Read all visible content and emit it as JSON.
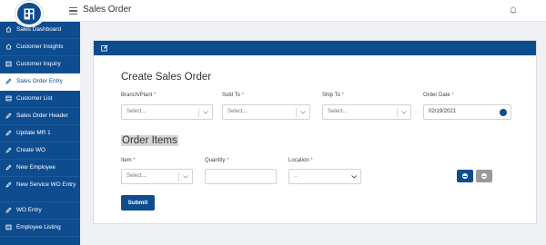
{
  "header": {
    "title": "Sales Order",
    "logo_icon": "building-icon",
    "notification_icon": "bell-icon"
  },
  "sidebar": {
    "items": [
      {
        "label": "Sales Dashboard",
        "icon": "home-icon"
      },
      {
        "label": "Customer Insights",
        "icon": "home-icon"
      },
      {
        "label": "Customer Inquiry",
        "icon": "table-icon"
      },
      {
        "label": "Sales Order Entry",
        "icon": "pencil-icon",
        "active": true
      },
      {
        "label": "Customer List",
        "icon": "table-icon"
      },
      {
        "label": "Sales Order Header",
        "icon": "pencil-icon"
      },
      {
        "label": "Update MR 1",
        "icon": "pencil-icon"
      },
      {
        "label": "Create WO",
        "icon": "pencil-icon"
      },
      {
        "label": "New Employee",
        "icon": "pencil-icon"
      },
      {
        "label": "New Service WO Entry",
        "icon": "pencil-icon"
      },
      {
        "label": "WO Entry",
        "icon": "pencil-icon"
      },
      {
        "label": "Employee Listing",
        "icon": "table-icon"
      }
    ]
  },
  "form": {
    "title": "Create Sales Order",
    "branch_label": "Branch/Plant",
    "branch_placeholder": "Select...",
    "sold_to_label": "Sold To",
    "sold_to_placeholder": "Select...",
    "ship_to_label": "Ship To",
    "ship_to_placeholder": "Select...",
    "order_date_label": "Order Date",
    "order_date_value": "02/19/2021",
    "required_mark": "*"
  },
  "items": {
    "title": "Order Items",
    "item_label": "Item",
    "item_placeholder": "Select...",
    "quantity_label": "Quantity",
    "quantity_value": "",
    "location_label": "Location",
    "location_value": "..",
    "add_icon": "plus-circle-icon",
    "remove_icon": "minus-circle-icon"
  },
  "actions": {
    "submit_label": "Submit"
  },
  "colors": {
    "primary": "#0d4c8f",
    "required": "#d9534f",
    "secondary_button": "#9a9a9a"
  }
}
